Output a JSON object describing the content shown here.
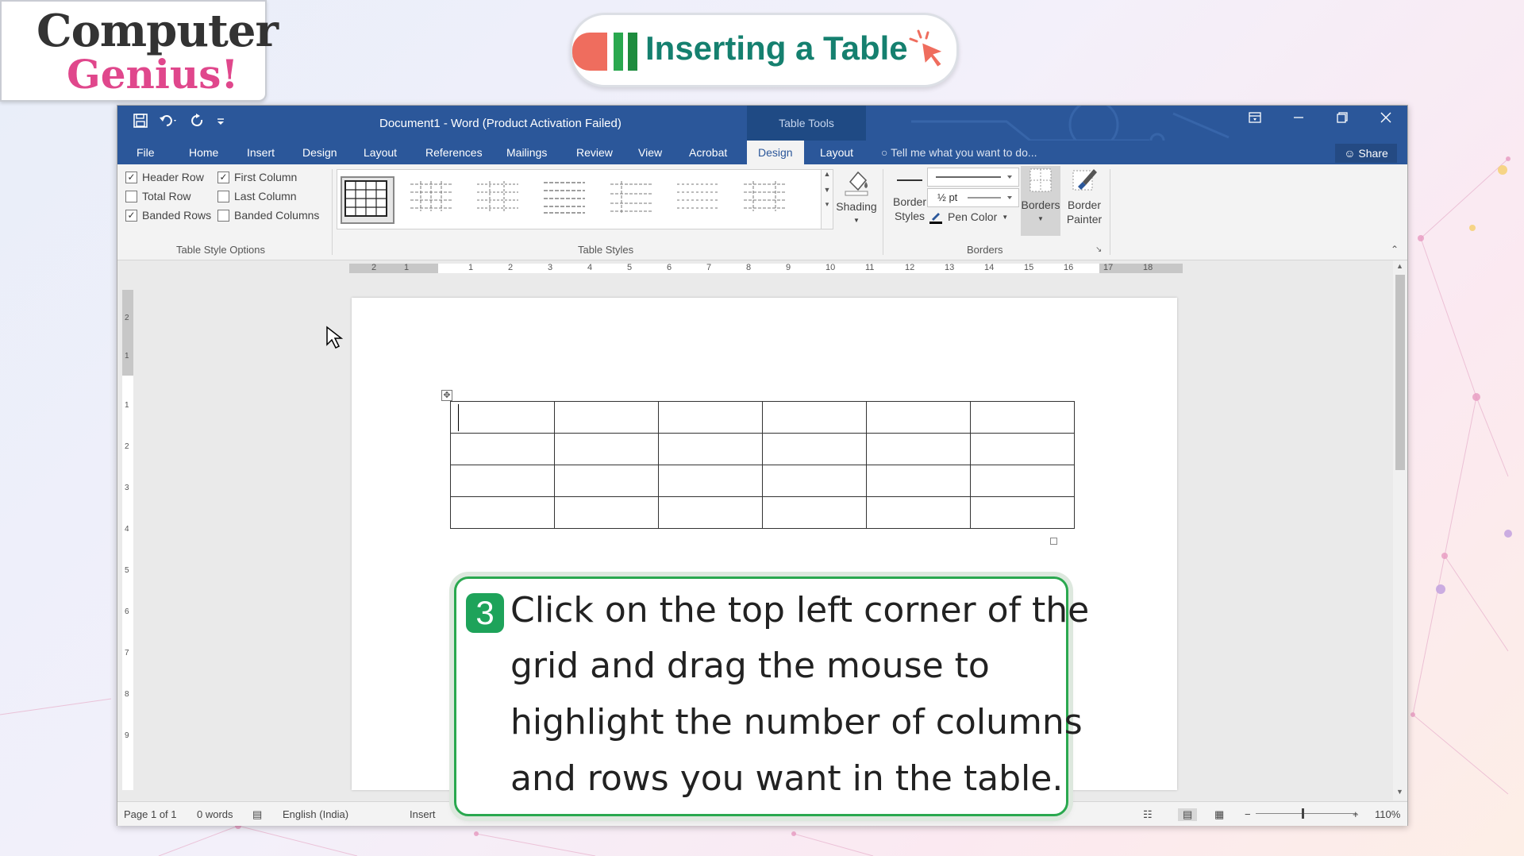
{
  "brand": {
    "line1": "Computer",
    "line2": "Genius!"
  },
  "lesson_title": "Inserting a Table",
  "word": {
    "document_title": "Document1 - Word (Product Activation Failed)",
    "contextual_tab_group": "Table Tools",
    "tabs": [
      "File",
      "Home",
      "Insert",
      "Design",
      "Layout",
      "References",
      "Mailings",
      "Review",
      "View",
      "Acrobat",
      "Design",
      "Layout"
    ],
    "active_tab_index": 10,
    "tell_me": "Tell me what you want to do...",
    "share": "Share",
    "table_style_options": {
      "header_row": {
        "label": "Header Row",
        "checked": true
      },
      "first_column": {
        "label": "First Column",
        "checked": true
      },
      "total_row": {
        "label": "Total Row",
        "checked": false
      },
      "last_column": {
        "label": "Last Column",
        "checked": false
      },
      "banded_rows": {
        "label": "Banded Rows",
        "checked": true
      },
      "banded_columns": {
        "label": "Banded Columns",
        "checked": false
      },
      "group_label": "Table Style Options"
    },
    "table_styles": {
      "group_label": "Table Styles",
      "shading": "Shading"
    },
    "borders": {
      "border_styles_line1": "Border",
      "border_styles_line2": "Styles",
      "weight": "½ pt",
      "pen_color": "Pen Color",
      "borders_btn": "Borders",
      "border_painter_line1": "Border",
      "border_painter_line2": "Painter",
      "group_label": "Borders"
    },
    "ruler_ticks": [
      "2",
      "1",
      "1",
      "2",
      "3",
      "4",
      "5",
      "6",
      "7",
      "8",
      "9",
      "10",
      "11",
      "12",
      "13",
      "14",
      "15",
      "16",
      "17",
      "18"
    ],
    "vruler_ticks": [
      "2",
      "1",
      "1",
      "2",
      "3",
      "4",
      "5",
      "6",
      "7",
      "8",
      "9"
    ],
    "table": {
      "rows": 4,
      "columns": 6
    },
    "status": {
      "page": "Page 1 of 1",
      "words": "0 words",
      "language": "English (India)",
      "mode": "Insert",
      "zoom": "110%"
    }
  },
  "callout": {
    "number": "3",
    "lines": [
      "Click on the top left corner of the",
      "grid and drag the mouse to",
      "highlight the number of columns",
      "and rows you want in the table."
    ]
  },
  "colors": {
    "word_blue": "#2b579a",
    "callout_green": "#2aa84f",
    "title_teal": "#15806f",
    "brand_pink": "#e0478c"
  }
}
